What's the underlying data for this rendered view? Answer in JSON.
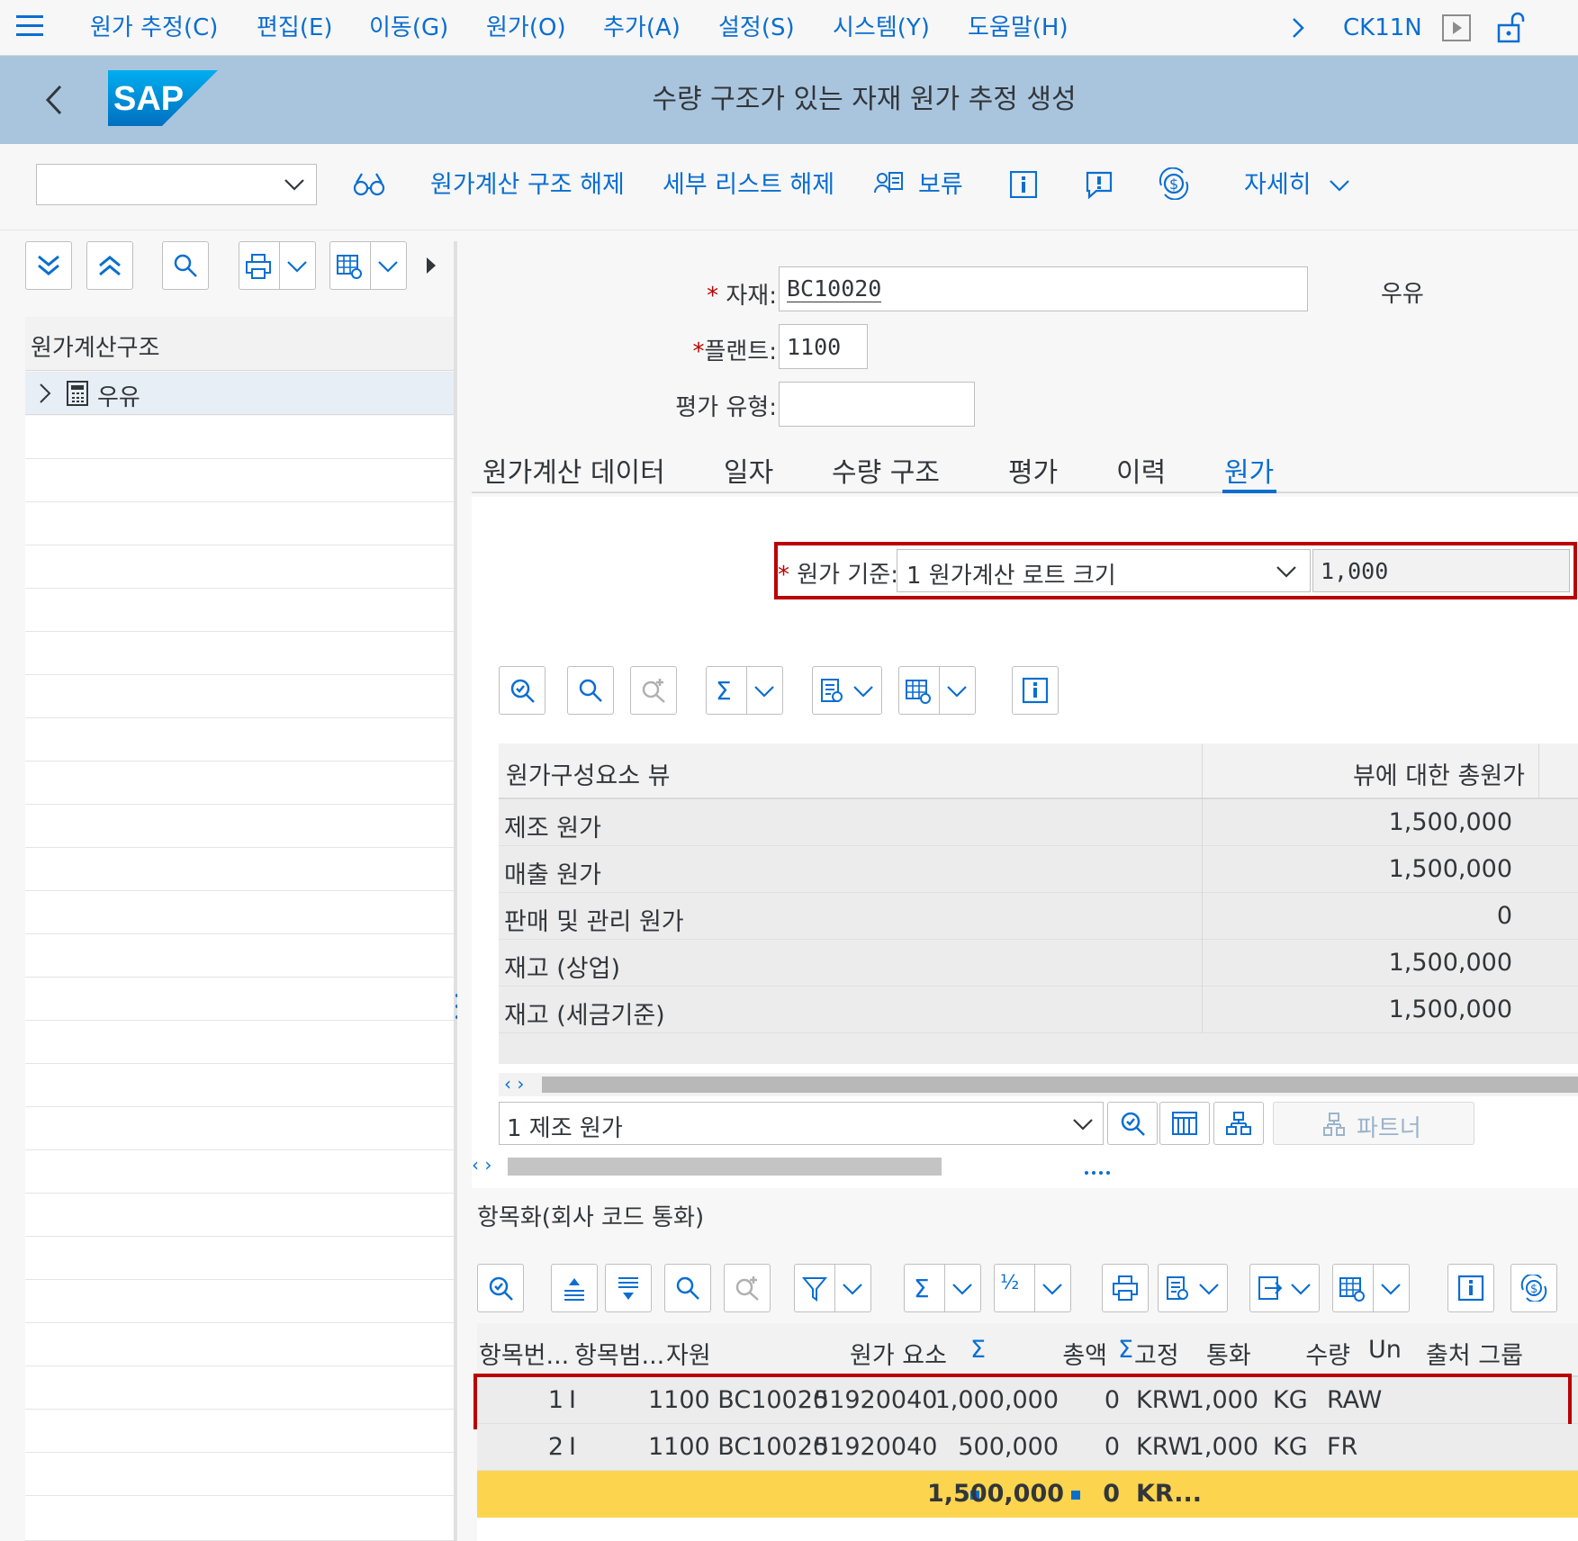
{
  "menubar": {
    "items": [
      "원가 추정(C)",
      "편집(E)",
      "이동(G)",
      "원가(O)",
      "추가(A)",
      "설정(S)",
      "시스템(Y)",
      "도움말(H)"
    ],
    "tcode": "CK11N"
  },
  "titlebar": {
    "logo": "SAP",
    "title": "수량 구조가 있는 자재 원가 추정 생성"
  },
  "toolbar": {
    "dropdown_value": "",
    "btn_release_structure": "원가계산 구조 해제",
    "btn_release_list": "세부 리스트 해제",
    "btn_hold": "보류",
    "btn_more": "자세히"
  },
  "left": {
    "tree_header": "원가계산구조",
    "tree_items": [
      {
        "label": "우유"
      }
    ]
  },
  "form": {
    "material_label": "자재:",
    "material_value": "BC10020",
    "material_desc": "우유",
    "plant_label": "플랜트:",
    "plant_value": "1100",
    "valtype_label": "평가 유형:",
    "valtype_value": ""
  },
  "tabs": [
    "원가계산 데이터",
    "일자",
    "수량 구조",
    "평가",
    "이력",
    "원가"
  ],
  "active_tab": "원가",
  "cost_basis": {
    "label": "원가 기준:",
    "select_value": "1 원가계산 로트 크기",
    "value": "1,000"
  },
  "cost_view": {
    "columns": [
      "원가구성요소 뷰",
      "뷰에 대한 총원가"
    ],
    "rows": [
      {
        "name": "제조 원가",
        "total": "1,500,000"
      },
      {
        "name": "매출 원가",
        "total": "1,500,000"
      },
      {
        "name": "판매 및 관리 원가",
        "total": "0"
      },
      {
        "name": "재고 (상업)",
        "total": "1,500,000"
      },
      {
        "name": "재고 (세금기준)",
        "total": "1,500,000"
      }
    ]
  },
  "view_select": {
    "value": "1 제조 원가",
    "partner_label": "파트너"
  },
  "itemization": {
    "title": "항목화(회사 코드 통화)",
    "columns": [
      "항목번...",
      "항목범...",
      "자원",
      "원가 요소",
      "Σ",
      "총액",
      "Σ",
      "고정",
      "통화",
      "수량",
      "Un",
      "출처 그룹"
    ],
    "rows": [
      {
        "item": "1",
        "cat": "I",
        "resource": "1100 BC10020",
        "cost_element": "51920040",
        "total": "1,000,000",
        "fixed": "0",
        "currency": "KRW",
        "qty": "1,000",
        "unit": "KG",
        "origin": "RAW"
      },
      {
        "item": "2",
        "cat": "I",
        "resource": "1100 BC10020",
        "cost_element": "51920040",
        "total": "500,000",
        "fixed": "0",
        "currency": "KRW",
        "qty": "1,000",
        "unit": "KG",
        "origin": "FR"
      }
    ],
    "totals": {
      "total": "1,500,000",
      "fixed": "0",
      "currency": "KR..."
    }
  },
  "colors": {
    "accent": "#0a6ed1",
    "highlight": "#bb0000",
    "total_row": "#fdd44e",
    "titlebar": "#a9c5de"
  }
}
